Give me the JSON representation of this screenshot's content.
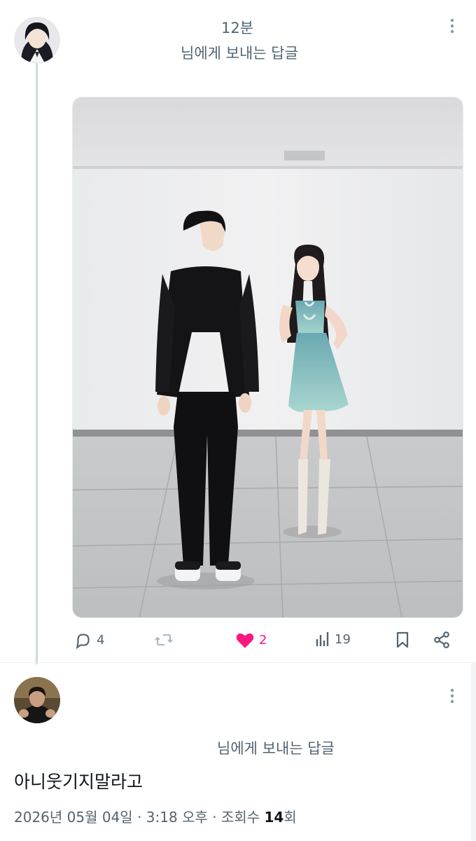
{
  "reply_post": {
    "time": "12분",
    "reply_to": "님에게 보내는 답글",
    "actions": {
      "replies": "4",
      "reposts": "",
      "likes": "2",
      "views": "19"
    }
  },
  "main_post": {
    "reply_to": "님에게 보내는 답글",
    "text": "아니웃기지말라고",
    "date": "2026년 05월 04일",
    "time": "3:18 오후",
    "views_label": "조회수",
    "views_count": "14",
    "views_suffix": "회"
  },
  "colors": {
    "like": "#f91880",
    "secondary_text": "#536471",
    "thread_line": "#cfd9de"
  },
  "icons": [
    "reply-icon",
    "repost-icon",
    "heart-icon",
    "views-icon",
    "bookmark-icon",
    "share-icon",
    "more-icon"
  ]
}
